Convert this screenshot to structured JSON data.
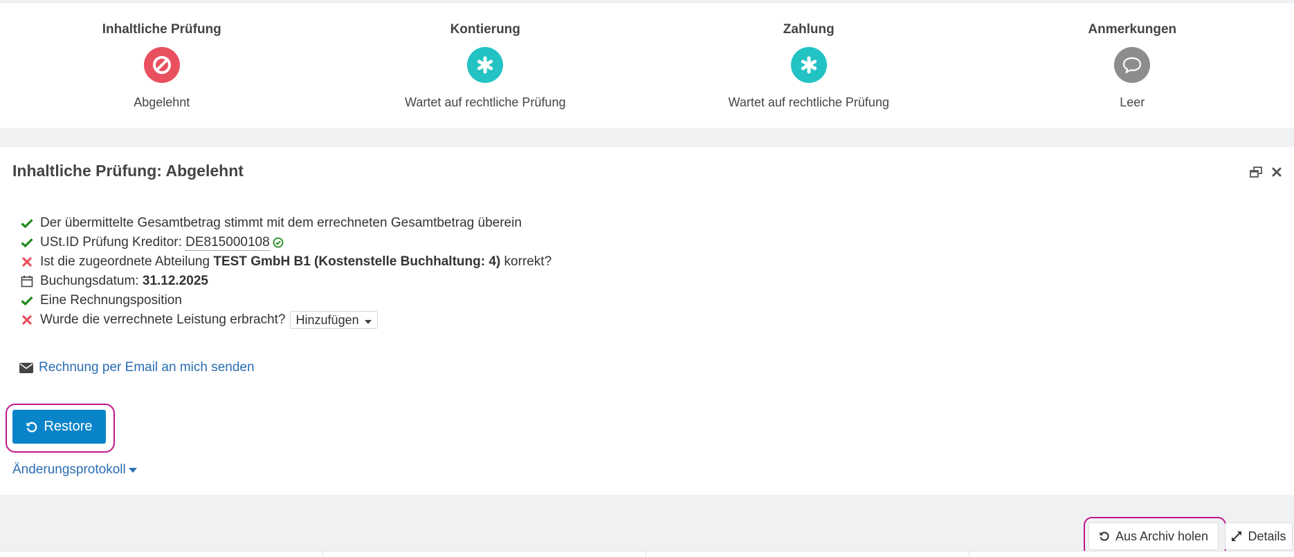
{
  "workflow": {
    "steps": [
      {
        "title": "Inhaltliche Prüfung",
        "status": "Abgelehnt",
        "icon": "ban-icon",
        "color": "#e9505e"
      },
      {
        "title": "Kontierung",
        "status": "Wartet auf rechtliche Prüfung",
        "icon": "asterisk-icon",
        "color": "#23c3c4"
      },
      {
        "title": "Zahlung",
        "status": "Wartet auf rechtliche Prüfung",
        "icon": "asterisk-icon",
        "color": "#23c3c4"
      },
      {
        "title": "Anmerkungen",
        "status": "Leer",
        "icon": "comment-icon",
        "color": "#8d8d8d"
      }
    ]
  },
  "panel": {
    "title": "Inhaltliche Prüfung: Abgelehnt",
    "checks": {
      "total": "Der übermittelte Gesamtbetrag stimmt mit dem errechneten Gesamtbetrag überein",
      "vat_label": "USt.ID Prüfung Kreditor: ",
      "vat_id": "DE815000108",
      "dept_prefix": "Ist die zugeordnete Abteilung ",
      "dept_name": "TEST GmbH B1 (Kostenstelle Buchhaltung: 4)",
      "dept_suffix": " korrekt?",
      "booking_label": "Buchungsdatum: ",
      "booking_date": "31.12.2025",
      "positions": "Eine Rechnungsposition",
      "service_question": "Wurde die verrechnete Leistung erbracht?",
      "add_button": "Hinzufügen"
    },
    "email_link": "Rechnung per Email an mich senden",
    "restore_button": "Restore",
    "log_link": "Änderungsprotokoll"
  },
  "toolbar": {
    "archive_button": "Aus Archiv holen",
    "details_button": "Details"
  },
  "colors": {
    "success": "#1e8a1e",
    "danger": "#e9505e",
    "primary": "#0a84c9",
    "link": "#2a6db3",
    "highlight": "#c0158d"
  }
}
